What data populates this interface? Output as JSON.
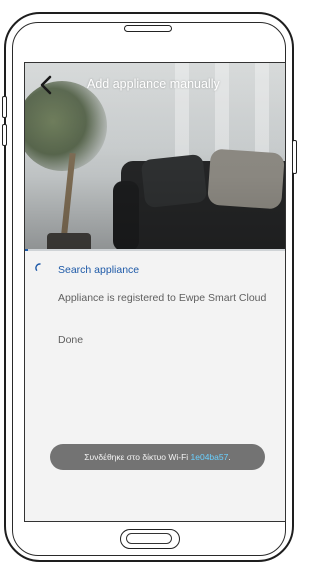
{
  "header": {
    "title": "Add appliance manually",
    "back_icon": "chevron-left-icon"
  },
  "progress": {
    "fraction": 0.01
  },
  "steps": [
    {
      "label": "Search appliance",
      "state": "active"
    },
    {
      "label": "Appliance is registered to Ewpe Smart Cloud",
      "state": "pending"
    },
    {
      "label": "Done",
      "state": "pending"
    }
  ],
  "toast": {
    "prefix": "Συνδέθηκε στο δίκτυο Wi-Fi ",
    "ssid": "1e04ba57",
    "suffix": "."
  },
  "colors": {
    "accent": "#1e5aa8",
    "ssid": "#6ad0ff",
    "toast_bg": "#737373"
  },
  "icons": {
    "spinner": "loading-spinner-icon",
    "back": "chevron-left-icon"
  }
}
